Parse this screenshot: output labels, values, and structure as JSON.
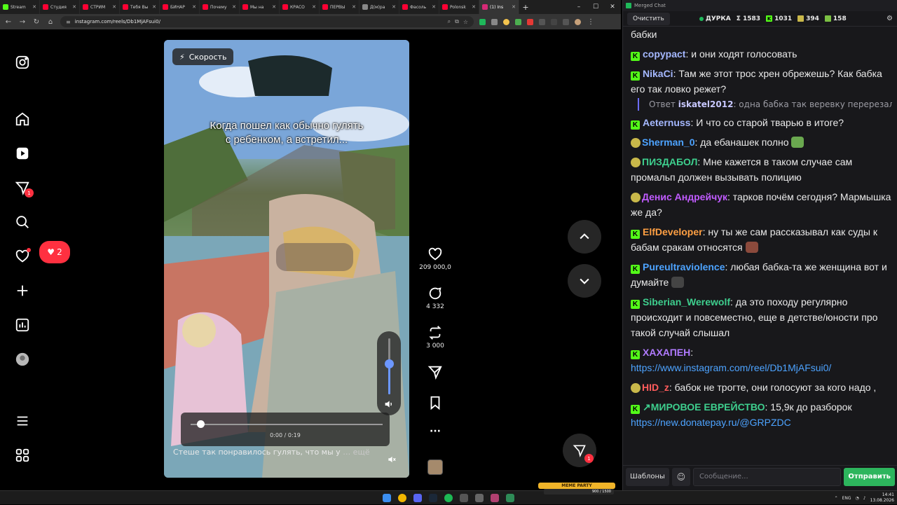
{
  "browser": {
    "tabs": [
      {
        "label": "Stream",
        "color": "#53fc18",
        "active": false
      },
      {
        "label": "Студия",
        "color": "#ff0033",
        "active": false
      },
      {
        "label": "СТРИМ",
        "color": "#ff0033",
        "active": false
      },
      {
        "label": "Тебя Вы",
        "color": "#ff0033",
        "active": false
      },
      {
        "label": "БИНАР",
        "color": "#ff0033",
        "active": false
      },
      {
        "label": "Почему",
        "color": "#ff0033",
        "active": false
      },
      {
        "label": "Мы на",
        "color": "#ff0033",
        "active": false
      },
      {
        "label": "КРАСО",
        "color": "#ff0033",
        "active": false
      },
      {
        "label": "ПЕРВЫ",
        "color": "#ff0033",
        "active": false
      },
      {
        "label": "Д(м)ра",
        "color": "#888888",
        "active": false
      },
      {
        "label": "Фасоль",
        "color": "#ff0033",
        "active": false
      },
      {
        "label": "Polonsk",
        "color": "#ff0033",
        "active": false
      },
      {
        "label": "(1) Ins",
        "color": "#d62976",
        "active": true
      }
    ],
    "new_tab": "+",
    "win_min": "–",
    "win_max": "☐",
    "win_close": "✕",
    "back": "←",
    "forward": "→",
    "reload": "↻",
    "home": "⌂",
    "url": "instagram.com/reels/Db1MjAFsui0/"
  },
  "instagram": {
    "speed_label": "Скорость",
    "video_caption": "Когда пошел как обычно гулять с ребенком, а встретил...",
    "progress_fraction": 0.05,
    "volume_fraction": 0.55,
    "time": "0:00 / 0:19",
    "description": "Стеше так понравилось гулять, что мы у",
    "more": "… ещё",
    "likes_count": "209 000,0",
    "comments_count": "4 332",
    "reposts_count": "3 000",
    "messages_badge": "1",
    "notif_likes": "2",
    "fab_badge": "1",
    "more_icon": "···"
  },
  "chat": {
    "title": "Merged Chat",
    "clear_label": "Очистить",
    "channel": "ДУРКА",
    "total": "Σ 1583",
    "kick_count": "1031",
    "twitch_count": "394",
    "vk_count": "158",
    "settings": "⚙",
    "messages": [
      {
        "platform": "",
        "user": "",
        "user_color": "#eaeaea",
        "text": "бабки",
        "emote_color": ""
      },
      {
        "platform": "K",
        "user": "copypact",
        "user_color": "#a5b8ff",
        "text": ": и они ходят голосовать",
        "emote_color": ""
      },
      {
        "platform": "K",
        "user": "NikaCi",
        "user_color": "#a5b8ff",
        "text": ": Там же этот трос хрен обрежешь? Как бабка его так ловко режет?",
        "emote_color": ""
      },
      {
        "platform": "K",
        "user": "Aeternuss",
        "user_color": "#a5b8ff",
        "text": ": И что со старой тварью в итоге?",
        "emote_color": ""
      },
      {
        "platform": "",
        "user": "Sherman_0",
        "user_color": "#4da3ff",
        "text": ": да ебанашек полно",
        "emote_color": "#6aa84f"
      },
      {
        "platform": "",
        "user": "ПИЗДАБОЛ",
        "user_color": "#3ecf8e",
        "text": ": Мне кажется в таком случае сам промальп должен вызывать полицию",
        "emote_color": ""
      },
      {
        "platform": "",
        "user": "Денис Андрейчук",
        "user_color": "#c05bff",
        "text": ": тарков почём сегодня? Мармышка же да?",
        "emote_color": ""
      },
      {
        "platform": "K",
        "user": "ElfDeveloper",
        "user_color": "#ff9f43",
        "text": ": ну ты же сам рассказывал как суды к бабам сракам относятся",
        "emote_color": "#8b4a3c"
      },
      {
        "platform": "K",
        "user": "Pureultraviolence",
        "user_color": "#4da3ff",
        "text": ": любая бабка-та же женщина вот и думайте",
        "emote_color": "#444444"
      },
      {
        "platform": "K",
        "user": "Siberian_Werewolf",
        "user_color": "#3ecf8e",
        "text": ": да это походу регулярно происходит и повсеместно, еще в детстве/юности про такой случай слышал",
        "emote_color": ""
      },
      {
        "platform": "K",
        "user": "ХАХАПЕН",
        "user_color": "#b07aff",
        "text": ": ",
        "link": "https://www.instagram.com/reel/Db1MjAFsui0/",
        "emote_color": ""
      },
      {
        "platform": "",
        "user": "HID_z",
        "user_color": "#ff5c5c",
        "text": ": бабок не трогте, они голосуют за кого надо ,",
        "emote_color": ""
      },
      {
        "platform": "K",
        "user": "↗МИРОВОЕ ЕВРЕЙСТВО",
        "user_color": "#3ecf8e",
        "text": ": 15,9к до разборок",
        "link": "https://new.donatepay.ru/@GRPZDC",
        "emote_color": ""
      }
    ],
    "reply": {
      "prefix": "Ответ",
      "user": "iskatel2012",
      "text": ": одна бабка так веревку перерезала,п..."
    },
    "templates_label": "Шаблоны",
    "emoji_label": "☺",
    "input_placeholder": "Сообщение...",
    "send_label": "Отправить"
  },
  "taskbar": {
    "memeparty": "MEME PARTY",
    "memeparty_count": "900 / 1500",
    "lang": "ENG",
    "time": "14:41",
    "date": "13.08.2026"
  }
}
